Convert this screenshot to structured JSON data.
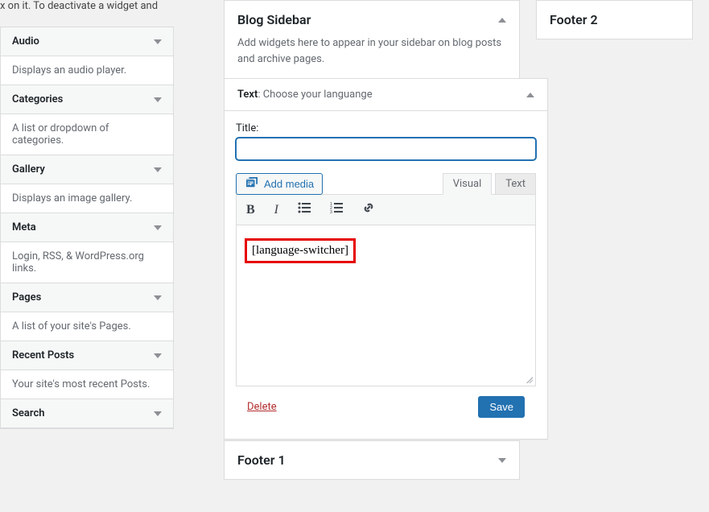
{
  "available": {
    "intro_text": "x on it. To deactivate a widget and",
    "widgets": [
      {
        "title": "Audio",
        "desc": "Displays an audio player."
      },
      {
        "title": "Categories",
        "desc": "A list or dropdown of categories."
      },
      {
        "title": "Gallery",
        "desc": "Displays an image gallery."
      },
      {
        "title": "Meta",
        "desc": "Login, RSS, & WordPress.org links."
      },
      {
        "title": "Pages",
        "desc": "A list of your site's Pages."
      },
      {
        "title": "Recent Posts",
        "desc": "Your site's most recent Posts."
      },
      {
        "title": "Search",
        "desc": ""
      }
    ]
  },
  "sidebar": {
    "title": "Blog Sidebar",
    "desc": "Add widgets here to appear in your sidebar on blog posts and archive pages.",
    "open_widget": {
      "type_label": "Text",
      "name": "Choose your languange",
      "title_label": "Title:",
      "title_value": "",
      "add_media": "Add media",
      "tabs": {
        "visual": "Visual",
        "text": "Text"
      },
      "content_shortcode": "[language-switcher]",
      "delete": "Delete",
      "save": "Save"
    }
  },
  "footer1": {
    "title": "Footer 1"
  },
  "footer2": {
    "title": "Footer 2"
  }
}
